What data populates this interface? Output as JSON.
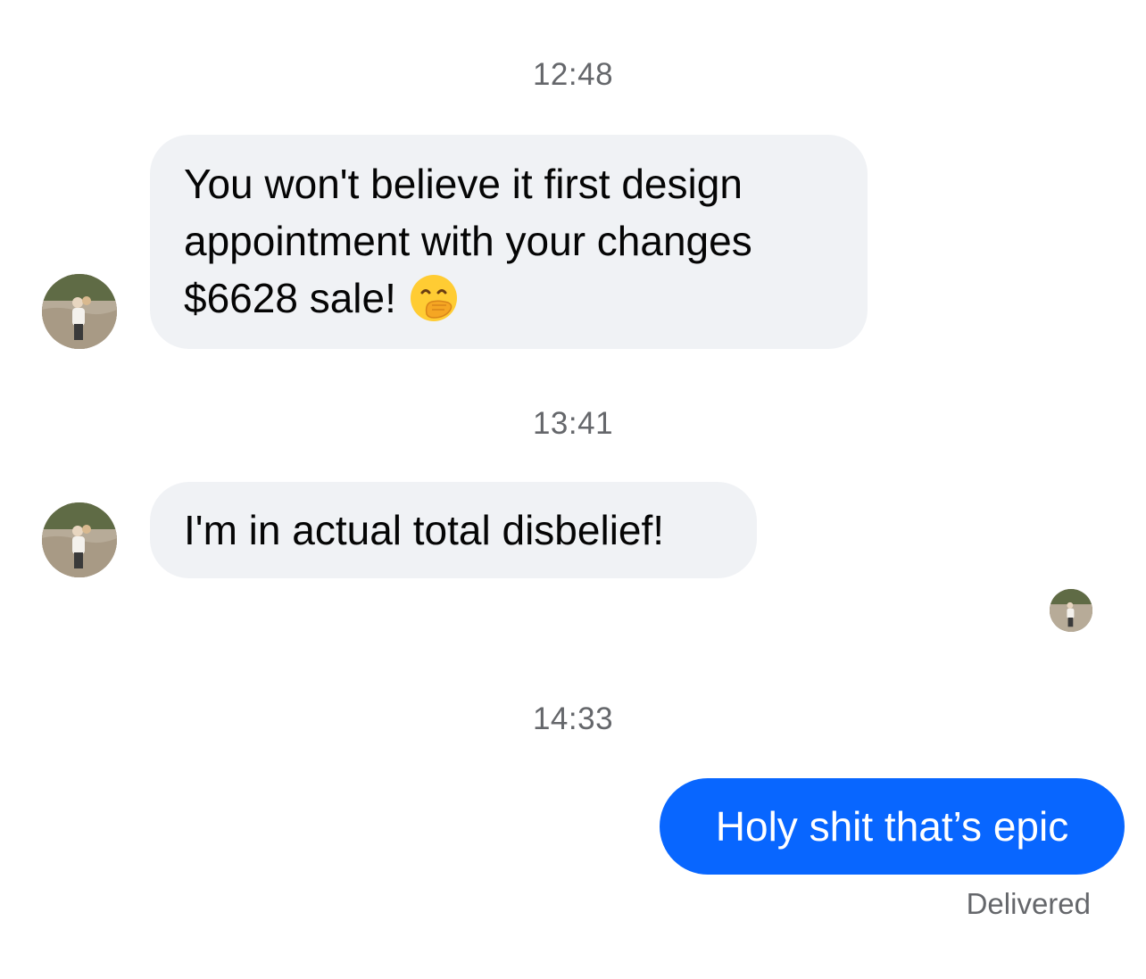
{
  "thread": {
    "messages": [
      {
        "time": "12:48",
        "direction": "incoming",
        "lines": [
          "You won't believe it first design",
          "appointment with your changes",
          "$6628 sale!"
        ],
        "emoji": "hand-over-mouth-emoji"
      },
      {
        "time": "13:41",
        "direction": "incoming",
        "text": "I'm in actual total disbelief!"
      },
      {
        "time": "14:33",
        "direction": "outgoing",
        "text": "Holy shit that’s epic",
        "status": "Delivered"
      }
    ]
  },
  "colors": {
    "incoming_bubble": "#f0f2f5",
    "outgoing_bubble": "#0866ff",
    "timestamp_text": "#65676b"
  },
  "icons": {
    "contact_avatar": "contact-avatar-photo",
    "read_receipt": "seen-avatar-icon"
  }
}
